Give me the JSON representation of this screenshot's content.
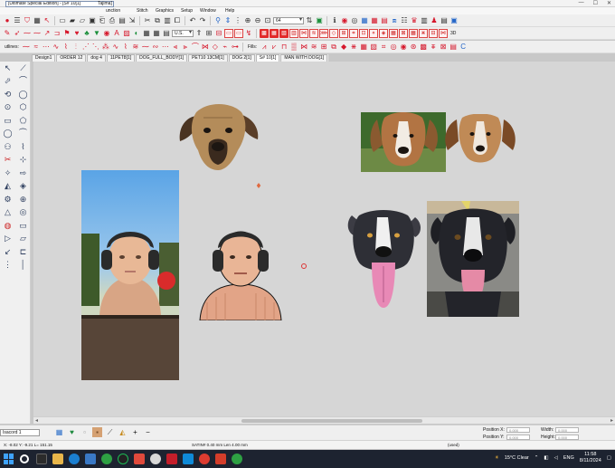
{
  "window": {
    "title_box": "[Ultimate Special Edition] - [S# 10[1]",
    "title_tail": "Tajima]",
    "title_center": "",
    "controls": [
      "—",
      "☐",
      "✕"
    ]
  },
  "menu": {
    "items": [
      {
        "label": "unction"
      },
      {
        "label": "Stitch"
      },
      {
        "label": "Graphics"
      },
      {
        "label": "Setup"
      },
      {
        "label": "Window"
      },
      {
        "label": "Help"
      }
    ]
  },
  "toolbar": {
    "zoom_combo": "U.S.",
    "value_combo": "64",
    "fills_label": "Fills:",
    "outlines_label": "utlines:",
    "threed_label": "3D"
  },
  "tabs": [
    {
      "label": "Design1",
      "active": false
    },
    {
      "label": "ORDER 12",
      "active": false
    },
    {
      "label": "dog 4",
      "active": false
    },
    {
      "label": "11PET8[1]",
      "active": false
    },
    {
      "label": "DOG_FULL_BODY[1]",
      "active": false
    },
    {
      "label": "PET10 13CM[1]",
      "active": false
    },
    {
      "label": "DOG 2[1]",
      "active": false
    },
    {
      "label": "S# 10[1]",
      "active": true
    },
    {
      "label": "MAN WITH DOG[1]",
      "active": false
    }
  ],
  "bottombar": {
    "thread_combo": "Isacord 1",
    "position_x_label": "Position X:",
    "position_x_value": "0.000",
    "position_y_label": "Position Y:",
    "position_y_value": "0.000",
    "width_label": "Width:",
    "width_value": "0.000",
    "height_label": "Height:",
    "height_value": "0.000"
  },
  "status": {
    "coords": "X: -8.02 Y: -9.21 L= 151.15",
    "stitch_info": "SATIN# 0.40 mm  Len 4.00 mm",
    "right_text": "(used)"
  },
  "taskbar": {
    "weather": "15°C  Clear",
    "lang": "ENG",
    "time": "11:58",
    "date": "8/11/2024"
  },
  "colors": {
    "accent_red": "#d6182c",
    "canvas_bg": "#d6d6d6",
    "taskbar_bg": "#1d2330"
  }
}
